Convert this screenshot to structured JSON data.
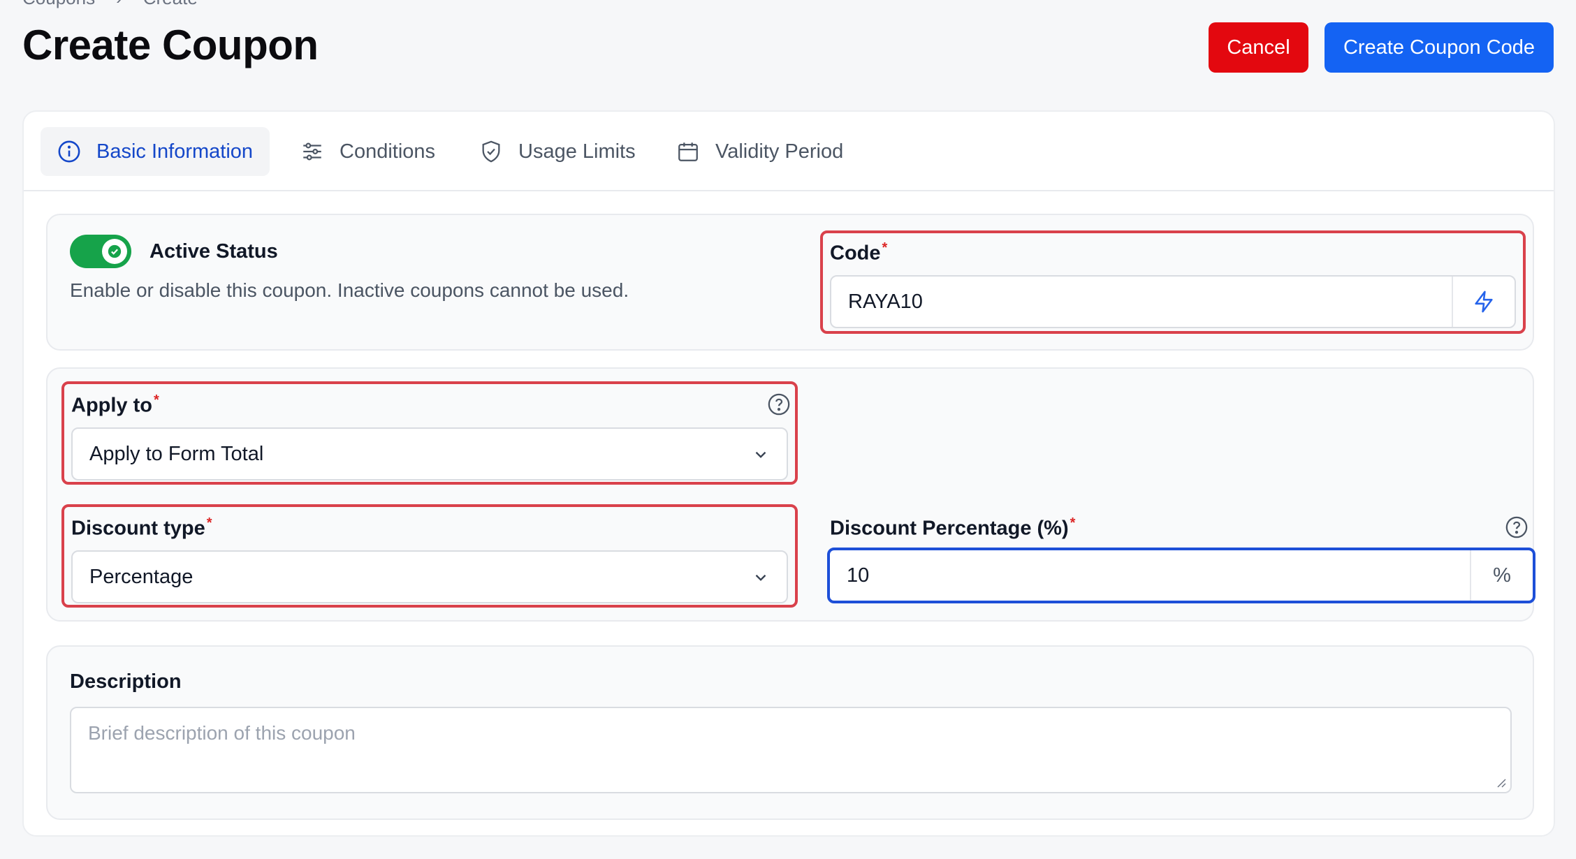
{
  "breadcrumb": [
    "Coupons",
    "Create"
  ],
  "page": {
    "title": "Create Coupon"
  },
  "actions": {
    "cancel": "Cancel",
    "create": "Create Coupon Code"
  },
  "tabs": [
    {
      "label": "Basic Information",
      "icon": "info-icon",
      "active": true
    },
    {
      "label": "Conditions",
      "icon": "sliders-icon",
      "active": false
    },
    {
      "label": "Usage Limits",
      "icon": "shield-check-icon",
      "active": false
    },
    {
      "label": "Validity Period",
      "icon": "calendar-icon",
      "active": false
    }
  ],
  "status": {
    "label": "Active Status",
    "description": "Enable or disable this coupon. Inactive coupons cannot be used.",
    "enabled": true
  },
  "code": {
    "label": "Code",
    "value": "RAYA10",
    "addon_icon": "lightning-icon"
  },
  "apply_to": {
    "label": "Apply to",
    "value": "Apply to Form Total"
  },
  "discount_type": {
    "label": "Discount type",
    "value": "Percentage"
  },
  "discount_percentage": {
    "label": "Discount Percentage (%)",
    "value": "10",
    "suffix": "%"
  },
  "description": {
    "label": "Description",
    "placeholder": "Brief description of this coupon"
  },
  "colors": {
    "primary": "#1463f3",
    "danger": "#e3080f",
    "success": "#16a34a",
    "highlight": "#d9414b"
  }
}
